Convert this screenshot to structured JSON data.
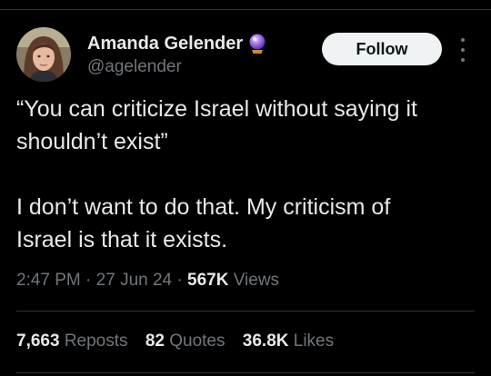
{
  "tweet": {
    "author": {
      "display_name": "Amanda Gelender",
      "handle": "@agelender",
      "badge_icon": "crystal-ball-icon",
      "avatar_icon": "profile-photo"
    },
    "follow_label": "Follow",
    "more_icon": "more-vertical-icon",
    "text": {
      "line1": "“You can criticize Israel without saying it",
      "line2": "shouldn’t exist”",
      "line3": "I don’t want to do that. My criticism of",
      "line4": "Israel is that it exists."
    },
    "meta": {
      "time": "2:47 PM",
      "sep1": " · ",
      "date": "27 Jun 24",
      "sep2": " · ",
      "views_count": "567K",
      "views_label": " Views"
    },
    "stats": {
      "reposts_count": "7,663",
      "reposts_label": "Reposts",
      "quotes_count": "82",
      "quotes_label": "Quotes",
      "likes_count": "36.8K",
      "likes_label": "Likes"
    },
    "colors": {
      "background": "#000000",
      "text_primary": "#e7e9ea",
      "text_secondary": "#71767b",
      "divider": "#2f3336",
      "follow_bg": "#eff3f4"
    }
  }
}
